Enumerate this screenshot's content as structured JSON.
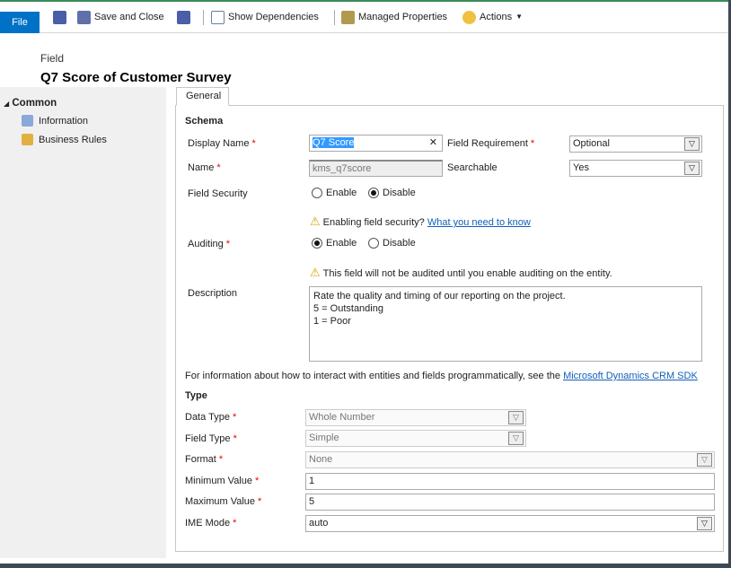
{
  "toolbar": {
    "file": "File",
    "save_and_close": "Save and Close",
    "show_dependencies": "Show Dependencies",
    "managed_properties": "Managed Properties",
    "actions": "Actions"
  },
  "header": {
    "entity": "Field",
    "title": "Q7 Score of Customer Survey"
  },
  "sidebar": {
    "group": "Common",
    "items": [
      {
        "label": "Information"
      },
      {
        "label": "Business Rules"
      }
    ]
  },
  "tabs": [
    {
      "label": "General"
    }
  ],
  "schema": {
    "heading": "Schema",
    "display_name_label": "Display Name",
    "display_name_value": "Q7 Score",
    "field_requirement_label": "Field Requirement",
    "field_requirement_value": "Optional",
    "name_label": "Name",
    "name_value": "kms_q7score",
    "searchable_label": "Searchable",
    "searchable_value": "Yes",
    "field_security_label": "Field Security",
    "field_security_enable": "Enable",
    "field_security_disable": "Disable",
    "field_security_warning": "Enabling field security?",
    "field_security_link": "What you need to know",
    "auditing_label": "Auditing",
    "auditing_enable": "Enable",
    "auditing_disable": "Disable",
    "auditing_warning": "This field will not be audited until you enable auditing on the entity.",
    "description_label": "Description",
    "description_lines": [
      "Rate the quality and timing of our reporting on the project.",
      "5 = Outstanding",
      "1 = Poor"
    ],
    "sdk_text": "For information about how to interact with entities and fields programmatically, see the",
    "sdk_link": "Microsoft Dynamics CRM SDK"
  },
  "type": {
    "heading": "Type",
    "data_type_label": "Data Type",
    "data_type_value": "Whole Number",
    "field_type_label": "Field Type",
    "field_type_value": "Simple",
    "format_label": "Format",
    "format_value": "None",
    "min_label": "Minimum Value",
    "min_value": "1",
    "max_label": "Maximum Value",
    "max_value": "5",
    "ime_label": "IME Mode",
    "ime_value": "auto"
  },
  "colors": {
    "file_button": "#0072c6",
    "link": "#1160b7",
    "required": "#e00000"
  }
}
